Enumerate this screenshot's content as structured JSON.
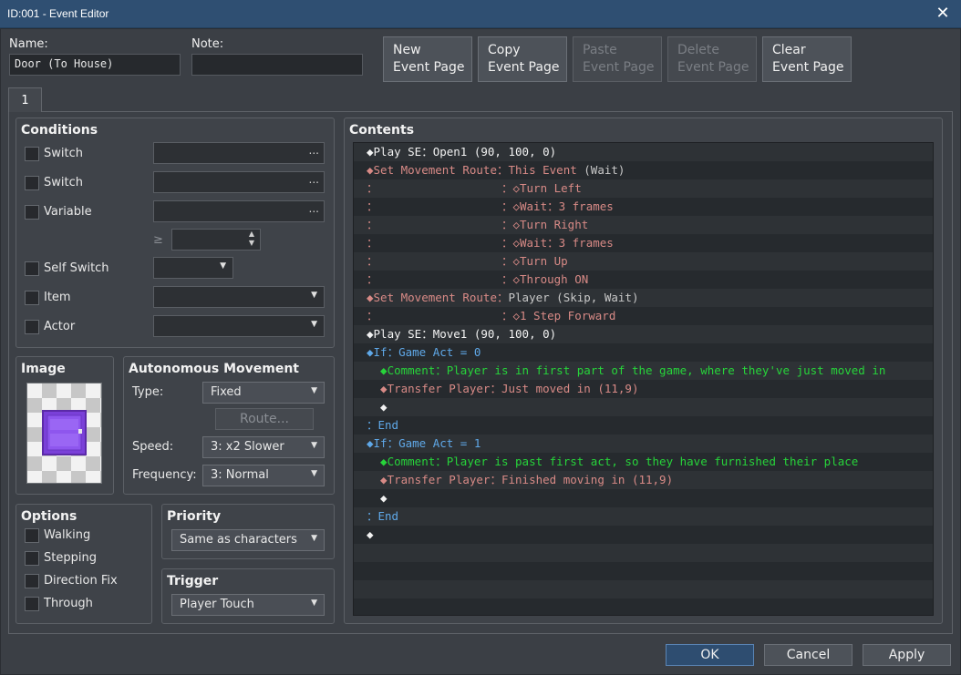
{
  "window": {
    "title": "ID:001 - Event Editor",
    "close_glyph": "✕"
  },
  "header": {
    "name_label": "Name:",
    "name_value": "Door (To House)",
    "note_label": "Note:",
    "note_value": ""
  },
  "page_buttons": {
    "new_line1": "New",
    "new_line2": "Event Page",
    "copy_line1": "Copy",
    "copy_line2": "Event Page",
    "paste_line1": "Paste",
    "paste_line2": "Event Page",
    "delete_line1": "Delete",
    "delete_line2": "Event Page",
    "clear_line1": "Clear",
    "clear_line2": "Event Page"
  },
  "tabs": [
    {
      "label": "1"
    }
  ],
  "conditions": {
    "title": "Conditions",
    "switch1_label": "Switch",
    "switch2_label": "Switch",
    "variable_label": "Variable",
    "gte_symbol": "≥",
    "self_switch_label": "Self Switch",
    "item_label": "Item",
    "actor_label": "Actor",
    "dots": "..."
  },
  "image": {
    "title": "Image"
  },
  "autonomous": {
    "title": "Autonomous Movement",
    "type_label": "Type:",
    "type_value": "Fixed",
    "route_button": "Route...",
    "speed_label": "Speed:",
    "speed_value": "3: x2 Slower",
    "frequency_label": "Frequency:",
    "frequency_value": "3: Normal"
  },
  "options": {
    "title": "Options",
    "walking": "Walking",
    "stepping": "Stepping",
    "direction_fix": "Direction Fix",
    "through": "Through"
  },
  "priority": {
    "title": "Priority",
    "value": "Same as characters"
  },
  "trigger": {
    "title": "Trigger",
    "value": "Player Touch"
  },
  "contents": {
    "title": "Contents",
    "lines": [
      [
        {
          "t": "◆Play SE：Open1 (90, 100, 0)",
          "c": "w"
        }
      ],
      [
        {
          "t": "◆Set Movement Route：This Event ",
          "c": "r"
        },
        {
          "t": "(Wait)",
          "c": "gray"
        }
      ],
      [
        {
          "t": "：                  ：◇Turn Left",
          "c": "r"
        }
      ],
      [
        {
          "t": "：                  ：◇Wait：3 frames",
          "c": "r"
        }
      ],
      [
        {
          "t": "：                  ：◇Turn Right",
          "c": "r"
        }
      ],
      [
        {
          "t": "：                  ：◇Wait：3 frames",
          "c": "r"
        }
      ],
      [
        {
          "t": "：                  ：◇Turn Up",
          "c": "r"
        }
      ],
      [
        {
          "t": "：                  ：◇Through ON",
          "c": "r"
        }
      ],
      [
        {
          "t": "◆Set Movement Route：",
          "c": "r"
        },
        {
          "t": "Player (Skip, Wait)",
          "c": "gray"
        }
      ],
      [
        {
          "t": "：                  ：◇1 Step Forward",
          "c": "r"
        }
      ],
      [
        {
          "t": "◆Play SE：Move1 (90, 100, 0)",
          "c": "w"
        }
      ],
      [
        {
          "t": "◆If：Game Act = 0",
          "c": "b"
        }
      ],
      [
        {
          "t": "  ◆Comment：Player is in first part of the game, where they've just moved in",
          "c": "g"
        }
      ],
      [
        {
          "t": "  ◆Transfer Player：Just moved in (11,9)",
          "c": "r"
        }
      ],
      [
        {
          "t": "  ◆",
          "c": "w"
        }
      ],
      [
        {
          "t": "：End",
          "c": "b"
        }
      ],
      [
        {
          "t": "◆If：Game Act = 1",
          "c": "b"
        }
      ],
      [
        {
          "t": "  ◆Comment：Player is past first act, so they have furnished their place",
          "c": "g"
        }
      ],
      [
        {
          "t": "  ◆Transfer Player：Finished moving in (11,9)",
          "c": "r"
        }
      ],
      [
        {
          "t": "  ◆",
          "c": "w"
        }
      ],
      [
        {
          "t": "：End",
          "c": "b"
        }
      ],
      [
        {
          "t": "◆",
          "c": "w"
        }
      ],
      [],
      [],
      [],
      []
    ]
  },
  "footer": {
    "ok": "OK",
    "cancel": "Cancel",
    "apply": "Apply"
  },
  "colors": {
    "titlebar": "#2f4f72",
    "cmd_red": "#d88a86",
    "cmd_blue": "#5fa8e8",
    "cmd_green": "#27d43a"
  }
}
